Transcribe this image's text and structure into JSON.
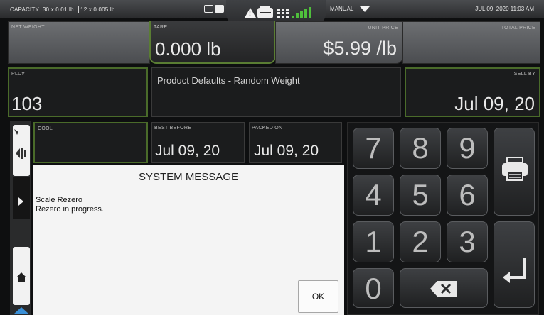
{
  "status_bar": {
    "capacity_label": "CAPACITY",
    "capacity_primary": "30 x 0.01 lb",
    "capacity_secondary": "12 x 0.005 lb",
    "mode": "MANUAL",
    "datetime": "JUL 09, 2020 11:03 AM"
  },
  "weights": {
    "net_weight_label": "NET WEIGHT",
    "tare_label": "TARE",
    "tare_value": "0.000 lb",
    "unit_price_label": "UNIT PRICE",
    "unit_price_value": "$5.99 /lb",
    "total_price_label": "TOTAL PRICE"
  },
  "product": {
    "plu_label": "PLU#",
    "plu_value": "103",
    "description": "Product Defaults - Random Weight",
    "sell_by_label": "SELL BY",
    "sell_by_value": "Jul 09, 20"
  },
  "dates": {
    "cool_label": "COOL",
    "best_before_label": "BEST BEFORE",
    "best_before_value": "Jul 09, 20",
    "packed_on_label": "PACKED ON",
    "packed_on_value": "Jul 09, 20"
  },
  "keypad": {
    "keys": [
      "7",
      "8",
      "9",
      "4",
      "5",
      "6",
      "1",
      "2",
      "3",
      "0"
    ],
    "icons": {
      "print": "printer-icon",
      "backspace": "backspace-icon",
      "enter": "enter-icon"
    }
  },
  "sidebar": {
    "icons": [
      "pointer-icon",
      "tare-icon",
      "expand-arrow-icon",
      "home-icon",
      "scroll-up-icon"
    ]
  },
  "dialog": {
    "title": "SYSTEM MESSAGE",
    "line1": "Scale Rezero",
    "line2": "Rezero in progress.",
    "ok_label": "OK"
  },
  "colors": {
    "accent_green": "#4a6b2a",
    "signal_green": "#4fbf3c"
  }
}
